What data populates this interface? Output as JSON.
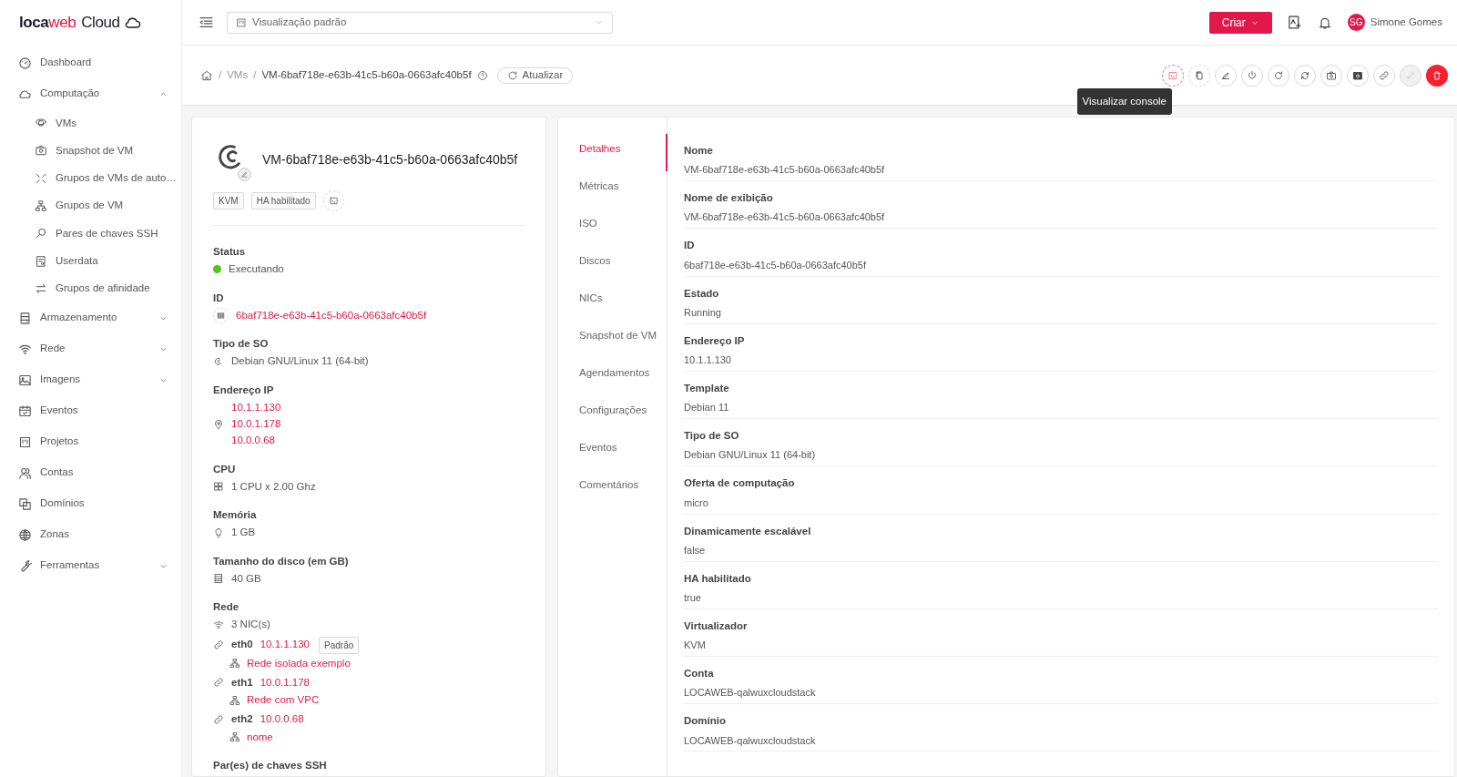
{
  "logo": [
    {
      "text": "loca",
      "color": "#1a1a2e"
    },
    {
      "text": "web",
      "color": "#e0173d"
    },
    {
      "text": "Cloud",
      "color": "#1a1a2e"
    }
  ],
  "sidebar": {
    "items": [
      {
        "label": "Dashboard"
      },
      {
        "label": "Computação",
        "expanded": true,
        "children": [
          {
            "label": "VMs"
          },
          {
            "label": "Snapshot de VM"
          },
          {
            "label": "Grupos de VMs de auto…"
          },
          {
            "label": "Grupos de VM"
          },
          {
            "label": "Pares de chaves SSH"
          },
          {
            "label": "Userdata"
          },
          {
            "label": "Grupos de afinidade"
          }
        ]
      },
      {
        "label": "Armazenamento",
        "expanded": false
      },
      {
        "label": "Rede",
        "expanded": false
      },
      {
        "label": "Imagens",
        "expanded": false
      },
      {
        "label": "Eventos"
      },
      {
        "label": "Projetos"
      },
      {
        "label": "Contas"
      },
      {
        "label": "Domínios"
      },
      {
        "label": "Zonas"
      },
      {
        "label": "Ferramentas",
        "expanded": false
      }
    ]
  },
  "header": {
    "view_select": "Visualização padrão",
    "create_button": "Criar",
    "user": {
      "initials": "SG",
      "name": "Simone Gomes"
    }
  },
  "breadcrumb_separator": "/",
  "breadcrumb": [
    "VMs",
    "VM-6baf718e-e63b-41c5-b60a-0663afc40b5f"
  ],
  "refresh_button": "Atualizar",
  "actions": [
    {
      "kind": "console",
      "disabled": false
    },
    {
      "kind": "copy",
      "disabled": false
    },
    {
      "kind": "edit",
      "disabled": false
    },
    {
      "kind": "power",
      "disabled": false
    },
    {
      "kind": "reboot",
      "disabled": false
    },
    {
      "kind": "reinstall",
      "disabled": false
    },
    {
      "kind": "snapshot",
      "disabled": false
    },
    {
      "kind": "backup",
      "disabled": false
    },
    {
      "kind": "link",
      "disabled": false
    },
    {
      "kind": "resize",
      "disabled": true
    },
    {
      "kind": "delete",
      "disabled": false
    }
  ],
  "tooltip": "Visualizar console",
  "vm": {
    "name": "VM-6baf718e-e63b-41c5-b60a-0663afc40b5f",
    "tags": [
      "KVM",
      "HA habilitado"
    ],
    "status": {
      "label": "Status",
      "value": "Executando",
      "color": "#52c41a"
    },
    "id": {
      "label": "ID",
      "value": "6baf718e-e63b-41c5-b60a-0663afc40b5f"
    },
    "os": {
      "label": "Tipo de SO",
      "value": "Debian GNU/Linux 11 (64-bit)"
    },
    "ips": {
      "label": "Endereço IP",
      "values": [
        "10.1.1.130",
        "10.0.1.178",
        "10.0.0.68"
      ]
    },
    "cpu": {
      "label": "CPU",
      "value": "1 CPU x 2.00 Ghz"
    },
    "memory": {
      "label": "Memória",
      "value": "1 GB"
    },
    "disk": {
      "label": "Tamanho do disco (em GB)",
      "value": "40 GB"
    },
    "network": {
      "label": "Rede",
      "count": "3 NIC(s)",
      "nics": [
        {
          "name": "eth0",
          "ip": "10.1.1.130",
          "badge": "Padrão",
          "network": "Rede isolada exemplo"
        },
        {
          "name": "eth1",
          "ip": "10.0.1.178",
          "network": "Rede com VPC"
        },
        {
          "name": "eth2",
          "ip": "10.0.0.68",
          "network": "nome"
        }
      ]
    },
    "ssh_label": "Par(es) de chaves SSH"
  },
  "tabs": [
    {
      "label": "Detalhes",
      "selected": true
    },
    {
      "label": "Métricas",
      "selected": false
    },
    {
      "label": "ISO",
      "selected": false
    },
    {
      "label": "Discos",
      "selected": false
    },
    {
      "label": "NICs",
      "selected": false
    },
    {
      "label": "Snapshot de VM",
      "selected": false
    },
    {
      "label": "Agendamentos",
      "selected": false
    },
    {
      "label": "Configurações",
      "selected": false
    },
    {
      "label": "Eventos",
      "selected": false
    },
    {
      "label": "Comentários",
      "selected": false
    }
  ],
  "details": [
    {
      "label": "Nome",
      "value": "VM-6baf718e-e63b-41c5-b60a-0663afc40b5f"
    },
    {
      "label": "Nome de exibição",
      "value": "VM-6baf718e-e63b-41c5-b60a-0663afc40b5f"
    },
    {
      "label": "ID",
      "value": "6baf718e-e63b-41c5-b60a-0663afc40b5f"
    },
    {
      "label": "Estado",
      "value": "Running"
    },
    {
      "label": "Endereço IP",
      "value": "10.1.1.130"
    },
    {
      "label": "Template",
      "value": "Debian 11"
    },
    {
      "label": "Tipo de SO",
      "value": "Debian GNU/Linux 11 (64-bit)"
    },
    {
      "label": "Oferta de computação",
      "value": "micro"
    },
    {
      "label": "Dinamicamente escalável",
      "value": "false"
    },
    {
      "label": "HA habilitado",
      "value": "true"
    },
    {
      "label": "Virtualizador",
      "value": "KVM"
    },
    {
      "label": "Conta",
      "value": "LOCAWEB-qalwuxcloudstack"
    },
    {
      "label": "Domínio",
      "value": "LOCAWEB-qalwuxcloudstack"
    }
  ]
}
